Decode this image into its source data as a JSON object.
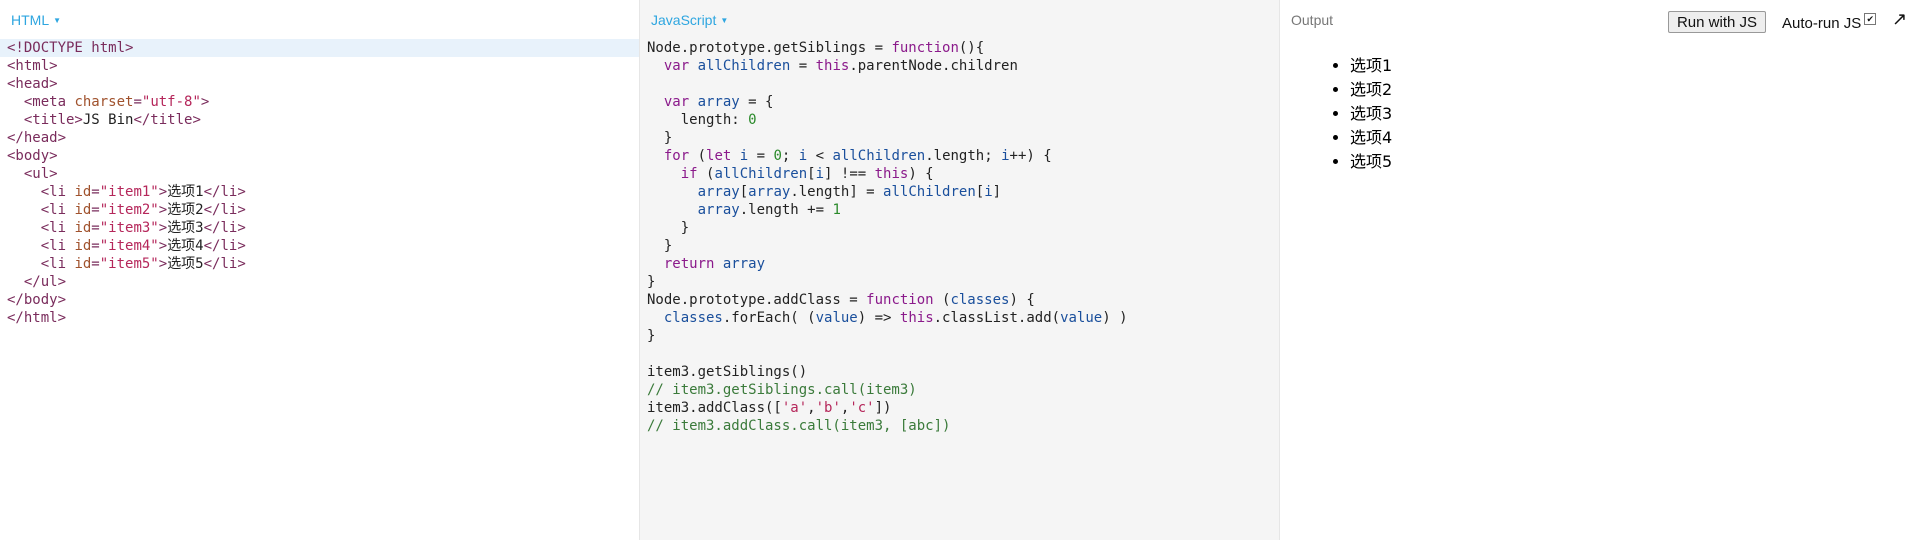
{
  "panels": {
    "html_title": "HTML",
    "js_title": "JavaScript",
    "output_title": "Output"
  },
  "output_bar": {
    "run_label": "Run with JS",
    "autorun_label": "Auto-run JS",
    "expand_icon": "↗"
  },
  "output_list": [
    "选项1",
    "选项2",
    "选项3",
    "选项4",
    "选项5"
  ],
  "html_code": [
    [
      [
        "tag",
        "<!DOCTYPE html>"
      ]
    ],
    [
      [
        "tag",
        "<html>"
      ]
    ],
    [
      [
        "tag",
        "<head>"
      ]
    ],
    [
      [
        "plain",
        "  "
      ],
      [
        "tag",
        "<meta "
      ],
      [
        "attr",
        "charset"
      ],
      [
        "tag",
        "="
      ],
      [
        "str",
        "\"utf-8\""
      ],
      [
        "tag",
        ">"
      ]
    ],
    [
      [
        "plain",
        "  "
      ],
      [
        "tag",
        "<title>"
      ],
      [
        "txt",
        "JS Bin"
      ],
      [
        "tag",
        "</title>"
      ]
    ],
    [
      [
        "tag",
        "</head>"
      ]
    ],
    [
      [
        "tag",
        "<body>"
      ]
    ],
    [
      [
        "plain",
        "  "
      ],
      [
        "tag",
        "<ul>"
      ]
    ],
    [
      [
        "plain",
        "    "
      ],
      [
        "tag",
        "<li "
      ],
      [
        "attr",
        "id"
      ],
      [
        "tag",
        "="
      ],
      [
        "str",
        "\"item1\""
      ],
      [
        "tag",
        ">"
      ],
      [
        "txt",
        "选项1"
      ],
      [
        "tag",
        "</li>"
      ]
    ],
    [
      [
        "plain",
        "    "
      ],
      [
        "tag",
        "<li "
      ],
      [
        "attr",
        "id"
      ],
      [
        "tag",
        "="
      ],
      [
        "str",
        "\"item2\""
      ],
      [
        "tag",
        ">"
      ],
      [
        "txt",
        "选项2"
      ],
      [
        "tag",
        "</li>"
      ]
    ],
    [
      [
        "plain",
        "    "
      ],
      [
        "tag",
        "<li "
      ],
      [
        "attr",
        "id"
      ],
      [
        "tag",
        "="
      ],
      [
        "str",
        "\"item3\""
      ],
      [
        "tag",
        ">"
      ],
      [
        "txt",
        "选项3"
      ],
      [
        "tag",
        "</li>"
      ]
    ],
    [
      [
        "plain",
        "    "
      ],
      [
        "tag",
        "<li "
      ],
      [
        "attr",
        "id"
      ],
      [
        "tag",
        "="
      ],
      [
        "str",
        "\"item4\""
      ],
      [
        "tag",
        ">"
      ],
      [
        "txt",
        "选项4"
      ],
      [
        "tag",
        "</li>"
      ]
    ],
    [
      [
        "plain",
        "    "
      ],
      [
        "tag",
        "<li "
      ],
      [
        "attr",
        "id"
      ],
      [
        "tag",
        "="
      ],
      [
        "str",
        "\"item5\""
      ],
      [
        "tag",
        ">"
      ],
      [
        "txt",
        "选项5"
      ],
      [
        "tag",
        "</li>"
      ]
    ],
    [
      [
        "plain",
        "  "
      ],
      [
        "tag",
        "</ul>"
      ]
    ],
    [
      [
        "tag",
        "</body>"
      ]
    ],
    [
      [
        "tag",
        "</html>"
      ]
    ]
  ],
  "js_code": [
    [
      [
        "plain",
        "Node.prototype.getSiblings = "
      ],
      [
        "kw",
        "function"
      ],
      [
        "plain",
        "(){"
      ]
    ],
    [
      [
        "plain",
        "  "
      ],
      [
        "kw",
        "var "
      ],
      [
        "var",
        "allChildren"
      ],
      [
        "plain",
        " = "
      ],
      [
        "kw",
        "this"
      ],
      [
        "plain",
        ".parentNode.children"
      ]
    ],
    [
      [
        "plain",
        ""
      ]
    ],
    [
      [
        "plain",
        "  "
      ],
      [
        "kw",
        "var "
      ],
      [
        "var",
        "array"
      ],
      [
        "plain",
        " = {"
      ]
    ],
    [
      [
        "plain",
        "    length: "
      ],
      [
        "num",
        "0"
      ]
    ],
    [
      [
        "plain",
        "  }"
      ]
    ],
    [
      [
        "plain",
        "  "
      ],
      [
        "kw",
        "for"
      ],
      [
        "plain",
        " ("
      ],
      [
        "kw",
        "let "
      ],
      [
        "var",
        "i"
      ],
      [
        "plain",
        " = "
      ],
      [
        "num",
        "0"
      ],
      [
        "plain",
        "; "
      ],
      [
        "var",
        "i"
      ],
      [
        "plain",
        " < "
      ],
      [
        "var",
        "allChildren"
      ],
      [
        "plain",
        ".length; "
      ],
      [
        "var",
        "i"
      ],
      [
        "plain",
        "++) {"
      ]
    ],
    [
      [
        "plain",
        "    "
      ],
      [
        "kw",
        "if"
      ],
      [
        "plain",
        " ("
      ],
      [
        "var",
        "allChildren"
      ],
      [
        "plain",
        "["
      ],
      [
        "var",
        "i"
      ],
      [
        "plain",
        "] !== "
      ],
      [
        "kw",
        "this"
      ],
      [
        "plain",
        ") {"
      ]
    ],
    [
      [
        "plain",
        "      "
      ],
      [
        "var",
        "array"
      ],
      [
        "plain",
        "["
      ],
      [
        "var",
        "array"
      ],
      [
        "plain",
        ".length] = "
      ],
      [
        "var",
        "allChildren"
      ],
      [
        "plain",
        "["
      ],
      [
        "var",
        "i"
      ],
      [
        "plain",
        "]"
      ]
    ],
    [
      [
        "plain",
        "      "
      ],
      [
        "var",
        "array"
      ],
      [
        "plain",
        ".length += "
      ],
      [
        "num",
        "1"
      ]
    ],
    [
      [
        "plain",
        "    }"
      ]
    ],
    [
      [
        "plain",
        "  }"
      ]
    ],
    [
      [
        "plain",
        "  "
      ],
      [
        "kw",
        "return "
      ],
      [
        "var",
        "array"
      ]
    ],
    [
      [
        "plain",
        "}"
      ]
    ],
    [
      [
        "plain",
        "Node.prototype.addClass = "
      ],
      [
        "kw",
        "function"
      ],
      [
        "plain",
        " ("
      ],
      [
        "var",
        "classes"
      ],
      [
        "plain",
        ") {"
      ]
    ],
    [
      [
        "plain",
        "  "
      ],
      [
        "var",
        "classes"
      ],
      [
        "plain",
        ".forEach( ("
      ],
      [
        "var",
        "value"
      ],
      [
        "plain",
        ") => "
      ],
      [
        "kw",
        "this"
      ],
      [
        "plain",
        ".classList.add("
      ],
      [
        "var",
        "value"
      ],
      [
        "plain",
        ") )"
      ]
    ],
    [
      [
        "plain",
        "}"
      ]
    ],
    [
      [
        "plain",
        ""
      ]
    ],
    [
      [
        "plain",
        "item3.getSiblings()"
      ]
    ],
    [
      [
        "com",
        "// item3.getSiblings.call(item3)"
      ]
    ],
    [
      [
        "plain",
        "item3.addClass(["
      ],
      [
        "str",
        "'a'"
      ],
      [
        "plain",
        ","
      ],
      [
        "str",
        "'b'"
      ],
      [
        "plain",
        ","
      ],
      [
        "str",
        "'c'"
      ],
      [
        "plain",
        "])"
      ]
    ],
    [
      [
        "com",
        "// item3.addClass.call(item3, [abc])"
      ]
    ]
  ]
}
